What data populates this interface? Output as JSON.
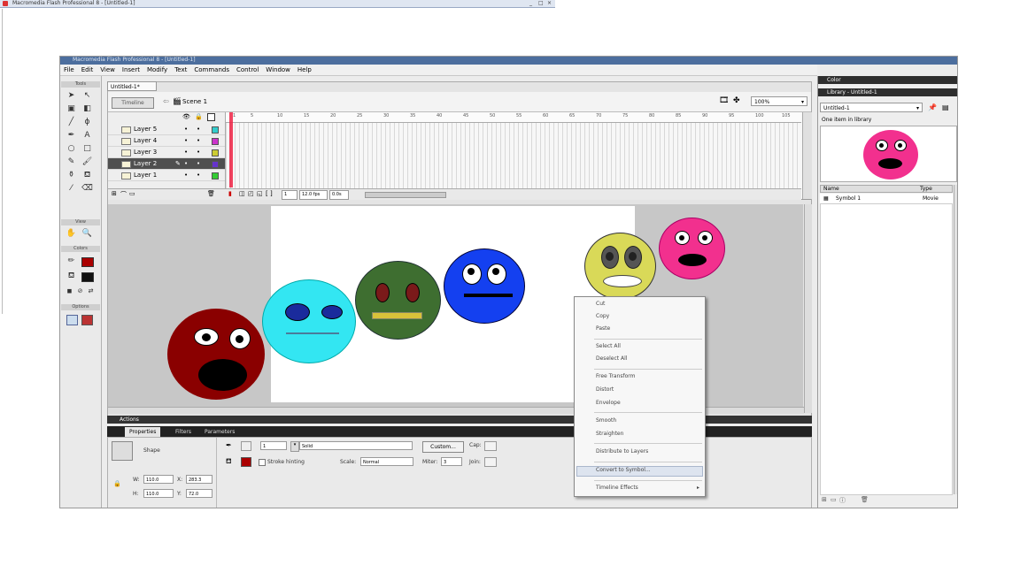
{
  "outer": {
    "title": "Macromedia Flash Professional 8 - [Untitled-1]"
  },
  "app": {
    "title": "Macromedia Flash Professional 8 - [Untitled-1]",
    "menu": [
      "File",
      "Edit",
      "View",
      "Insert",
      "Modify",
      "Text",
      "Commands",
      "Control",
      "Window",
      "Help"
    ]
  },
  "tools": {
    "header_tools": "Tools",
    "header_view": "View",
    "header_colors": "Colors",
    "header_options": "Options"
  },
  "document": {
    "tab": "Untitled-1*",
    "timeline_button": "Timeline",
    "scene": "Scene 1",
    "zoom": "100%"
  },
  "timeline": {
    "layers": [
      {
        "name": "Layer 5",
        "color": "#33cccc"
      },
      {
        "name": "Layer 4",
        "color": "#cc33cc"
      },
      {
        "name": "Layer 3",
        "color": "#cccc33"
      },
      {
        "name": "Layer 2",
        "color": "#6633cc",
        "selected": true
      },
      {
        "name": "Layer 1",
        "color": "#33cc33"
      }
    ],
    "ruler": [
      "1",
      "5",
      "10",
      "15",
      "20",
      "25",
      "30",
      "35",
      "40",
      "45",
      "50",
      "55",
      "60",
      "65",
      "70",
      "75",
      "80",
      "85",
      "90",
      "95",
      "100",
      "105"
    ],
    "frame": "1",
    "fps": "12.0 fps",
    "time": "0.0s"
  },
  "stage": {
    "faces": [
      {
        "name": "dark-red-face",
        "color": "#8a0000"
      },
      {
        "name": "cyan-face",
        "color": "#33e6f2"
      },
      {
        "name": "green-face",
        "color": "#3e6e30"
      },
      {
        "name": "blue-face",
        "color": "#1440f0"
      },
      {
        "name": "yellow-face",
        "color": "#d9d958"
      },
      {
        "name": "pink-face",
        "color": "#f2308e"
      }
    ]
  },
  "panels": {
    "actions": "Actions",
    "tabs": [
      "Properties",
      "Filters",
      "Parameters"
    ],
    "shape_label": "Shape",
    "stroke_size": "1",
    "stroke_style": "Solid",
    "custom_button": "Custom...",
    "cap_label": "Cap:",
    "stroke_hinting": "Stroke hinting",
    "scale_label": "Scale:",
    "scale_value": "Normal",
    "miter_label": "Miter:",
    "miter_value": "3",
    "join_label": "Join:",
    "w_label": "W:",
    "w_value": "110.0",
    "h_label": "H:",
    "h_value": "110.0",
    "x_label": "X:",
    "x_value": "283.3",
    "y_label": "Y:",
    "y_value": "72.0"
  },
  "library": {
    "color_header": "Color",
    "header": "Library - Untitled-1",
    "select": "Untitled-1",
    "count": "One item in library",
    "col_name": "Name",
    "col_type": "Type",
    "item_name": "Symbol 1",
    "item_type": "Movie"
  },
  "context_menu": {
    "items": [
      "Cut",
      "Copy",
      "Paste",
      "Select All",
      "Deselect All",
      "Free Transform",
      "Distort",
      "Envelope",
      "Smooth",
      "Straighten",
      "Distribute to Layers",
      "Convert to Symbol...",
      "Timeline Effects"
    ]
  }
}
